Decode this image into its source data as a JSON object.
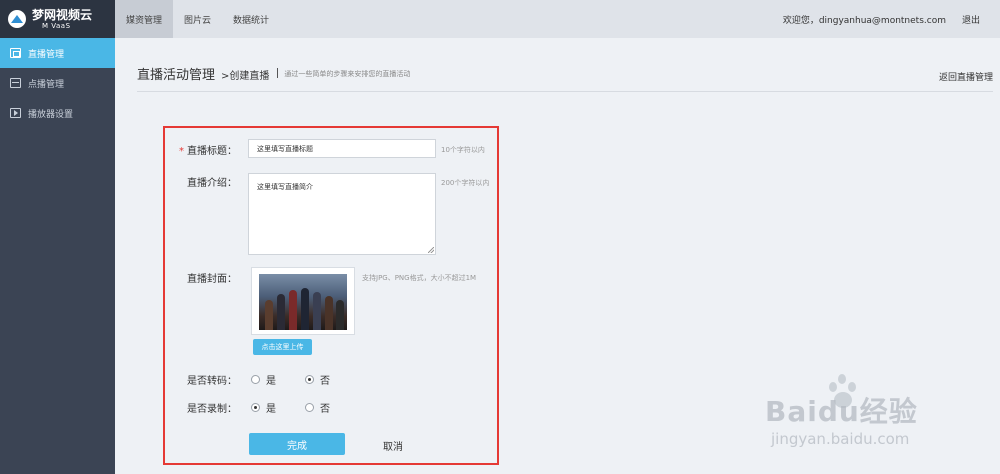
{
  "brand": {
    "name": "梦网视频云",
    "sub": "M VaaS"
  },
  "sidebar": {
    "items": [
      {
        "label": "直播管理",
        "icon": "broadcast-icon"
      },
      {
        "label": "点播管理",
        "icon": "video-grid-icon"
      },
      {
        "label": "播放器设置",
        "icon": "player-icon"
      }
    ]
  },
  "topbar": {
    "tabs": [
      {
        "label": "媒资管理"
      },
      {
        "label": "图片云"
      },
      {
        "label": "数据统计"
      }
    ],
    "welcome": "欢迎您，dingyanhua@montnets.com",
    "logout": "退出"
  },
  "header": {
    "title": "直播活动管理",
    "subtitle": ">创建直播",
    "description": "通过一些简单的步骤来安排您的直播活动",
    "back": "返回直播管理"
  },
  "form": {
    "title_label": "直播标题：",
    "title_value": "这里填写直播标题",
    "title_hint": "10个字符以内",
    "intro_label": "直播介绍：",
    "intro_value": "这里填写直播简介",
    "intro_hint": "200个字符以内",
    "cover_label": "直播封面：",
    "cover_hint": "支持JPG、PNG格式，大小不超过1M",
    "upload_label": "点击这里上传",
    "transcode_label": "是否转码：",
    "record_label": "是否录制：",
    "yes": "是",
    "no": "否",
    "transcode_selected": "否",
    "record_selected": "是",
    "submit": "完成",
    "cancel": "取消"
  },
  "watermark": {
    "text": "Baidu经验",
    "url": "jingyan.baidu.com"
  },
  "colors": {
    "accent": "#4ab7e6",
    "sidebar": "#3b4454",
    "highlight_border": "#e53935"
  }
}
